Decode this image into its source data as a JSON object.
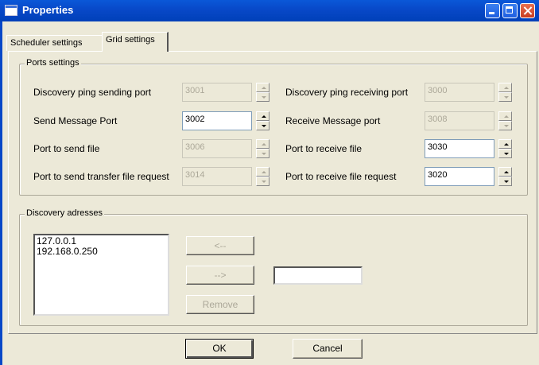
{
  "window": {
    "title": "Properties"
  },
  "tabs": [
    {
      "label": "Scheduler settings"
    },
    {
      "label": "Grid settings"
    }
  ],
  "ports_group": {
    "legend": "Ports settings",
    "fields": {
      "discovery_ping_send": {
        "label": "Discovery ping sending port",
        "value": "3001"
      },
      "discovery_ping_recv": {
        "label": "Discovery ping receiving port",
        "value": "3000"
      },
      "send_message": {
        "label": "Send Message Port",
        "value": "3002"
      },
      "receive_message": {
        "label": "Receive Message port",
        "value": "3008"
      },
      "send_file": {
        "label": "Port to send file",
        "value": "3006"
      },
      "receive_file": {
        "label": "Port to receive file",
        "value": "3030"
      },
      "send_transfer_request": {
        "label": "Port to send transfer file request",
        "value": "3014"
      },
      "receive_file_request": {
        "label": "Port to receive file request",
        "value": "3020"
      }
    }
  },
  "discovery_group": {
    "legend": "Discovery adresses",
    "addresses": [
      "127.0.0.1",
      "192.168.0.250"
    ],
    "buttons": {
      "add": "<--",
      "remove_arrow": "-->",
      "remove": "Remove"
    },
    "input_value": ""
  },
  "footer": {
    "ok": "OK",
    "cancel": "Cancel"
  }
}
